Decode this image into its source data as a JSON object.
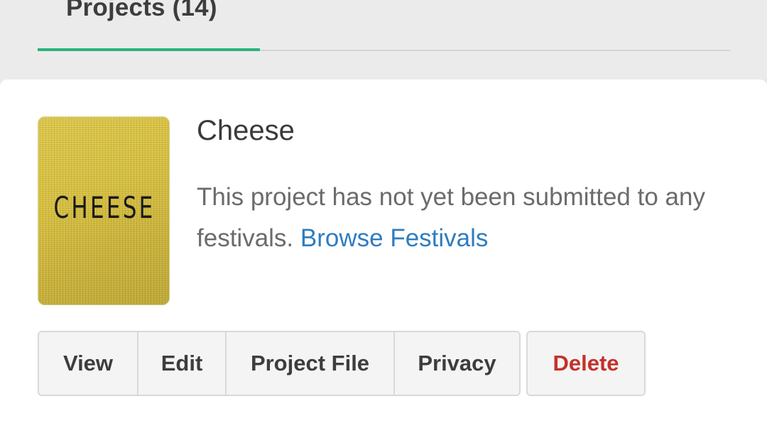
{
  "tabs": {
    "projects_label": "Projects (14)"
  },
  "project": {
    "thumbnail_text": "CHEESE",
    "title": "Cheese",
    "description": "This project has not yet been submitted to any festivals.",
    "browse_link": "Browse Festivals"
  },
  "actions": {
    "view": "View",
    "edit": "Edit",
    "project_file": "Project File",
    "privacy": "Privacy",
    "delete": "Delete"
  },
  "colors": {
    "accent_green": "#2bb27b",
    "link_blue": "#2e7dbf",
    "danger_red": "#c4312b"
  },
  "icons": []
}
